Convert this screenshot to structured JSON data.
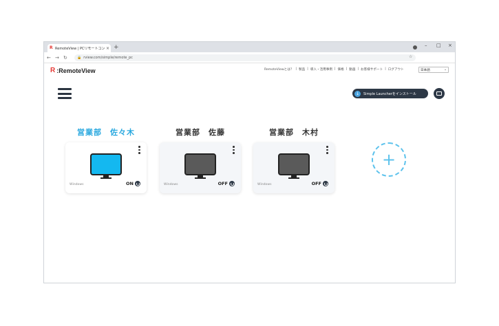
{
  "browser": {
    "tab_title": "RemoteView | PCリモートコントロ...",
    "tab_close": "×",
    "new_tab": "+",
    "url": "rview.com/simple/remote_pc",
    "controls": {
      "minimize": "–",
      "maximize": "□",
      "close": "×"
    }
  },
  "header": {
    "logo_mark": "R",
    "logo_text": ":RemoteView",
    "nav": [
      "RemoteViewとは？",
      "製品",
      "導入・活用事例",
      "価格",
      "動画",
      "お客様サポート",
      "ログアウト"
    ],
    "language": "日本語"
  },
  "toolbar": {
    "install_label": "Simple Launcherをインストール"
  },
  "devices": [
    {
      "name": "営業部　佐々木",
      "os": "Windows",
      "status": "ON",
      "active": true
    },
    {
      "name": "営業部　佐藤",
      "os": "Windows",
      "status": "OFF",
      "active": false
    },
    {
      "name": "営業部　木村",
      "os": "Windows",
      "status": "OFF",
      "active": false
    }
  ],
  "add_device_symbol": "+",
  "colors": {
    "accent": "#29a8df",
    "monitor_on": "#14b8f0",
    "monitor_off": "#5a5a5a",
    "dark": "#2d3846"
  },
  "icons": [
    "menu-icon",
    "download-icon",
    "screen-icon",
    "power-icon",
    "more-vertical-icon",
    "plus-icon"
  ]
}
